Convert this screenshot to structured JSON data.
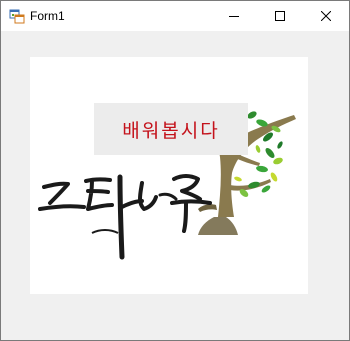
{
  "window": {
    "title": "Form1",
    "icon": "winforms-app-icon",
    "controls": {
      "minimize_icon": "minimize-icon",
      "maximize_icon": "maximize-icon",
      "close_icon": "close-icon"
    }
  },
  "form": {
    "background_color": "#f0f0f0",
    "picture": {
      "logo_text": "느티나무",
      "logo_graphic": "tree-logo"
    },
    "label": {
      "text": "배워봅시다",
      "color": "#c4121b",
      "background_color": "#ececec"
    }
  }
}
